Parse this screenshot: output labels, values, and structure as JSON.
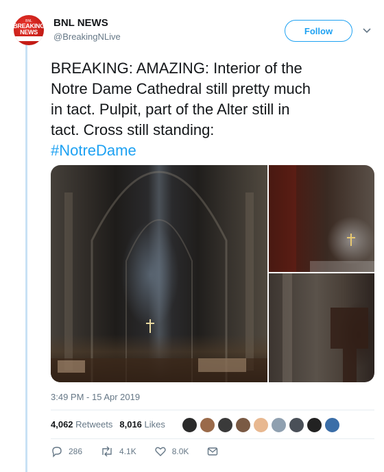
{
  "tweet": {
    "author": {
      "name": "BNL NEWS",
      "handle": "@BreakingNLive",
      "avatar": {
        "small_text": "BNL",
        "line1": "BREAKING",
        "line2": "NEWS"
      }
    },
    "follow_label": "Follow",
    "text_lines": [
      "BREAKING: AMAZING: Interior of the",
      "Notre Dame Cathedral still pretty much",
      "in tact. Pulpit, part of the Alter still in",
      "tact. Cross still standing:"
    ],
    "hashtag": "#NotreDame",
    "timestamp": "3:49 PM - 15 Apr 2019",
    "stats": {
      "retweets_count": "4,062",
      "retweets_label": "Retweets",
      "likes_count": "8,016",
      "likes_label": "Likes"
    },
    "likers": [
      {
        "name": "liker-1",
        "color": "#2b2b2b"
      },
      {
        "name": "liker-2",
        "color": "#9a6a4a"
      },
      {
        "name": "liker-3",
        "color": "#3a3a3a"
      },
      {
        "name": "liker-4",
        "color": "#7a5a44"
      },
      {
        "name": "liker-5",
        "color": "#e8b890"
      },
      {
        "name": "liker-6",
        "color": "#8fa0b0"
      },
      {
        "name": "liker-7",
        "color": "#4a5058"
      },
      {
        "name": "liker-8",
        "color": "#222222"
      },
      {
        "name": "liker-9",
        "color": "#3b6ea8"
      }
    ],
    "actions": {
      "replies": "286",
      "retweets": "4.1K",
      "likes": "8.0K"
    },
    "icons": [
      "chevron-down-icon",
      "reply-icon",
      "retweet-icon",
      "like-icon",
      "direct-message-icon"
    ],
    "colors": {
      "accent": "#1da1f2",
      "muted": "#657786",
      "thread_line": "#c8e1f5"
    }
  }
}
